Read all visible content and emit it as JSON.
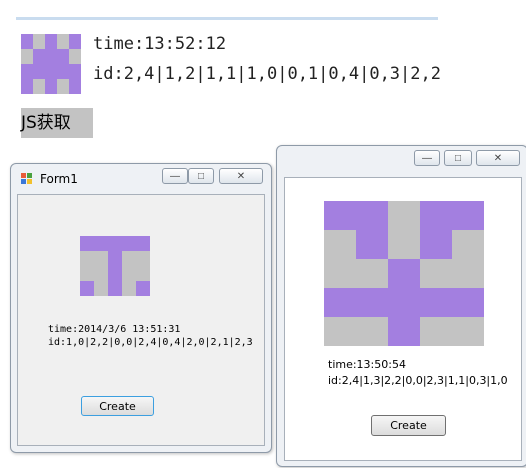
{
  "colors": {
    "purple": "#a37fe0",
    "gray": "#c3c3c3"
  },
  "web": {
    "pattern": [
      [
        "P",
        "G",
        "P",
        "G",
        "P"
      ],
      [
        "G",
        "P",
        "P",
        "P",
        "G"
      ],
      [
        "P",
        "P",
        "P",
        "P",
        "P"
      ],
      [
        "P",
        "G",
        "P",
        "G",
        "P"
      ]
    ],
    "time_text": "time:13:52:12",
    "id_text": "id:2,4|1,2|1,1|1,0|0,1|0,4|0,3|2,2",
    "button_label": "JS获取"
  },
  "form1": {
    "title": "Form1",
    "pattern": [
      [
        "P",
        "P",
        "P",
        "P",
        "P"
      ],
      [
        "G",
        "G",
        "P",
        "G",
        "G"
      ],
      [
        "G",
        "G",
        "P",
        "G",
        "G"
      ],
      [
        "P",
        "G",
        "P",
        "G",
        "P"
      ]
    ],
    "time_text": "time:2014/3/6 13:51:31",
    "id_text": "id:1,0|2,2|0,0|2,4|0,4|2,0|2,1|2,3",
    "button_label": "Create"
  },
  "form2": {
    "pattern": [
      [
        "P",
        "P",
        "G",
        "P",
        "P"
      ],
      [
        "G",
        "P",
        "G",
        "P",
        "G"
      ],
      [
        "G",
        "G",
        "P",
        "G",
        "G"
      ],
      [
        "P",
        "P",
        "P",
        "P",
        "P"
      ],
      [
        "G",
        "G",
        "P",
        "G",
        "G"
      ]
    ],
    "time_text": "time:13:50:54",
    "id_text": "id:2,4|1,3|2,2|0,0|2,3|1,1|0,3|1,0",
    "button_label": "Create"
  },
  "titlebar": {
    "minimize": "—",
    "maximize": "□",
    "close": "✕"
  }
}
